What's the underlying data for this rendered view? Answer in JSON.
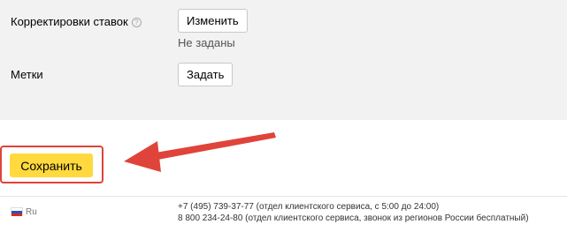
{
  "settings": {
    "bid_adjustments": {
      "label": "Корректировки ставок",
      "help_icon": "?",
      "button_label": "Изменить",
      "status": "Не заданы"
    },
    "tags": {
      "label": "Метки",
      "button_label": "Задать"
    }
  },
  "actions": {
    "save_label": "Сохранить"
  },
  "footer": {
    "language": "Ru",
    "phone_1": "+7 (495) 739-37-77 (отдел клиентского сервиса, с 5:00 до 24:00)",
    "phone_2": "8 800 234-24-80 (отдел клиентского сервиса, звонок из регионов России бесплатный)"
  },
  "colors": {
    "save_button": "#ffd93d",
    "highlight_frame": "#e0433a",
    "arrow": "#e0433a",
    "settings_bg": "#f2f2f2"
  }
}
